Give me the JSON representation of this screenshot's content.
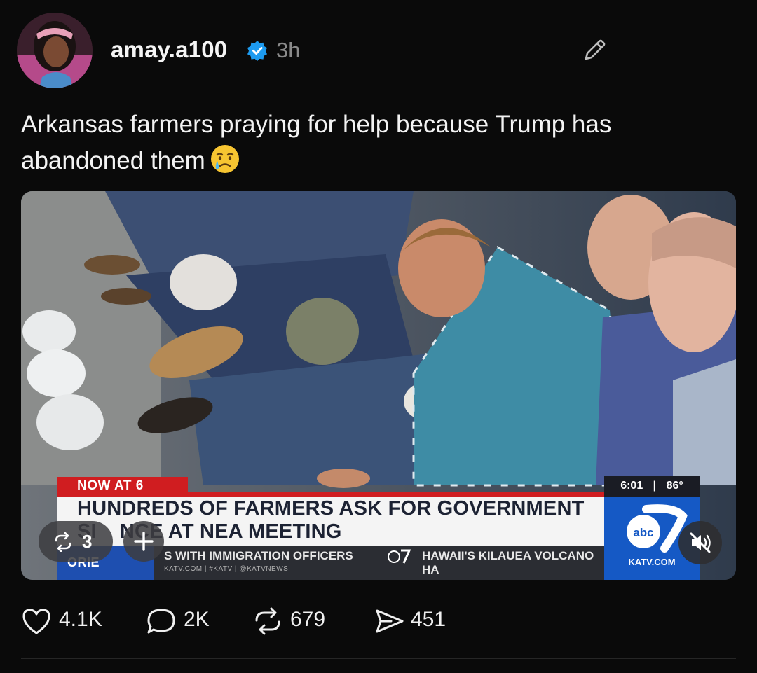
{
  "post": {
    "username": "amay.a100",
    "timestamp": "3h",
    "text": "Arkansas farmers praying for help because Trump has abandoned them",
    "emoji": "crying-face"
  },
  "media": {
    "broadcast": {
      "tag": "NOW AT 6",
      "headline_line1": "HUNDREDS OF FARMERS ASK FOR GOVERNMENT",
      "headline_line2": "SI    NCE AT NEA MEETING",
      "ticker_label": "ORIE",
      "ticker_item1": "S WITH IMMIGRATION OFFICERS",
      "ticker_item2": "HAWAII'S KILAUEA VOLCANO HA",
      "ticker_sub": "KATV.COM  |  #KATV  |  @KATVNEWS",
      "time": "6:01",
      "temperature": "86°",
      "station": "KATV.COM"
    },
    "repost_count": "3"
  },
  "actions": {
    "likes": "4.1K",
    "comments": "2K",
    "reposts": "679",
    "shares": "451"
  },
  "colors": {
    "background": "#0a0a0a",
    "verified": "#1d9bf0",
    "news_red": "#d01d20",
    "news_blue": "#1559c5"
  }
}
